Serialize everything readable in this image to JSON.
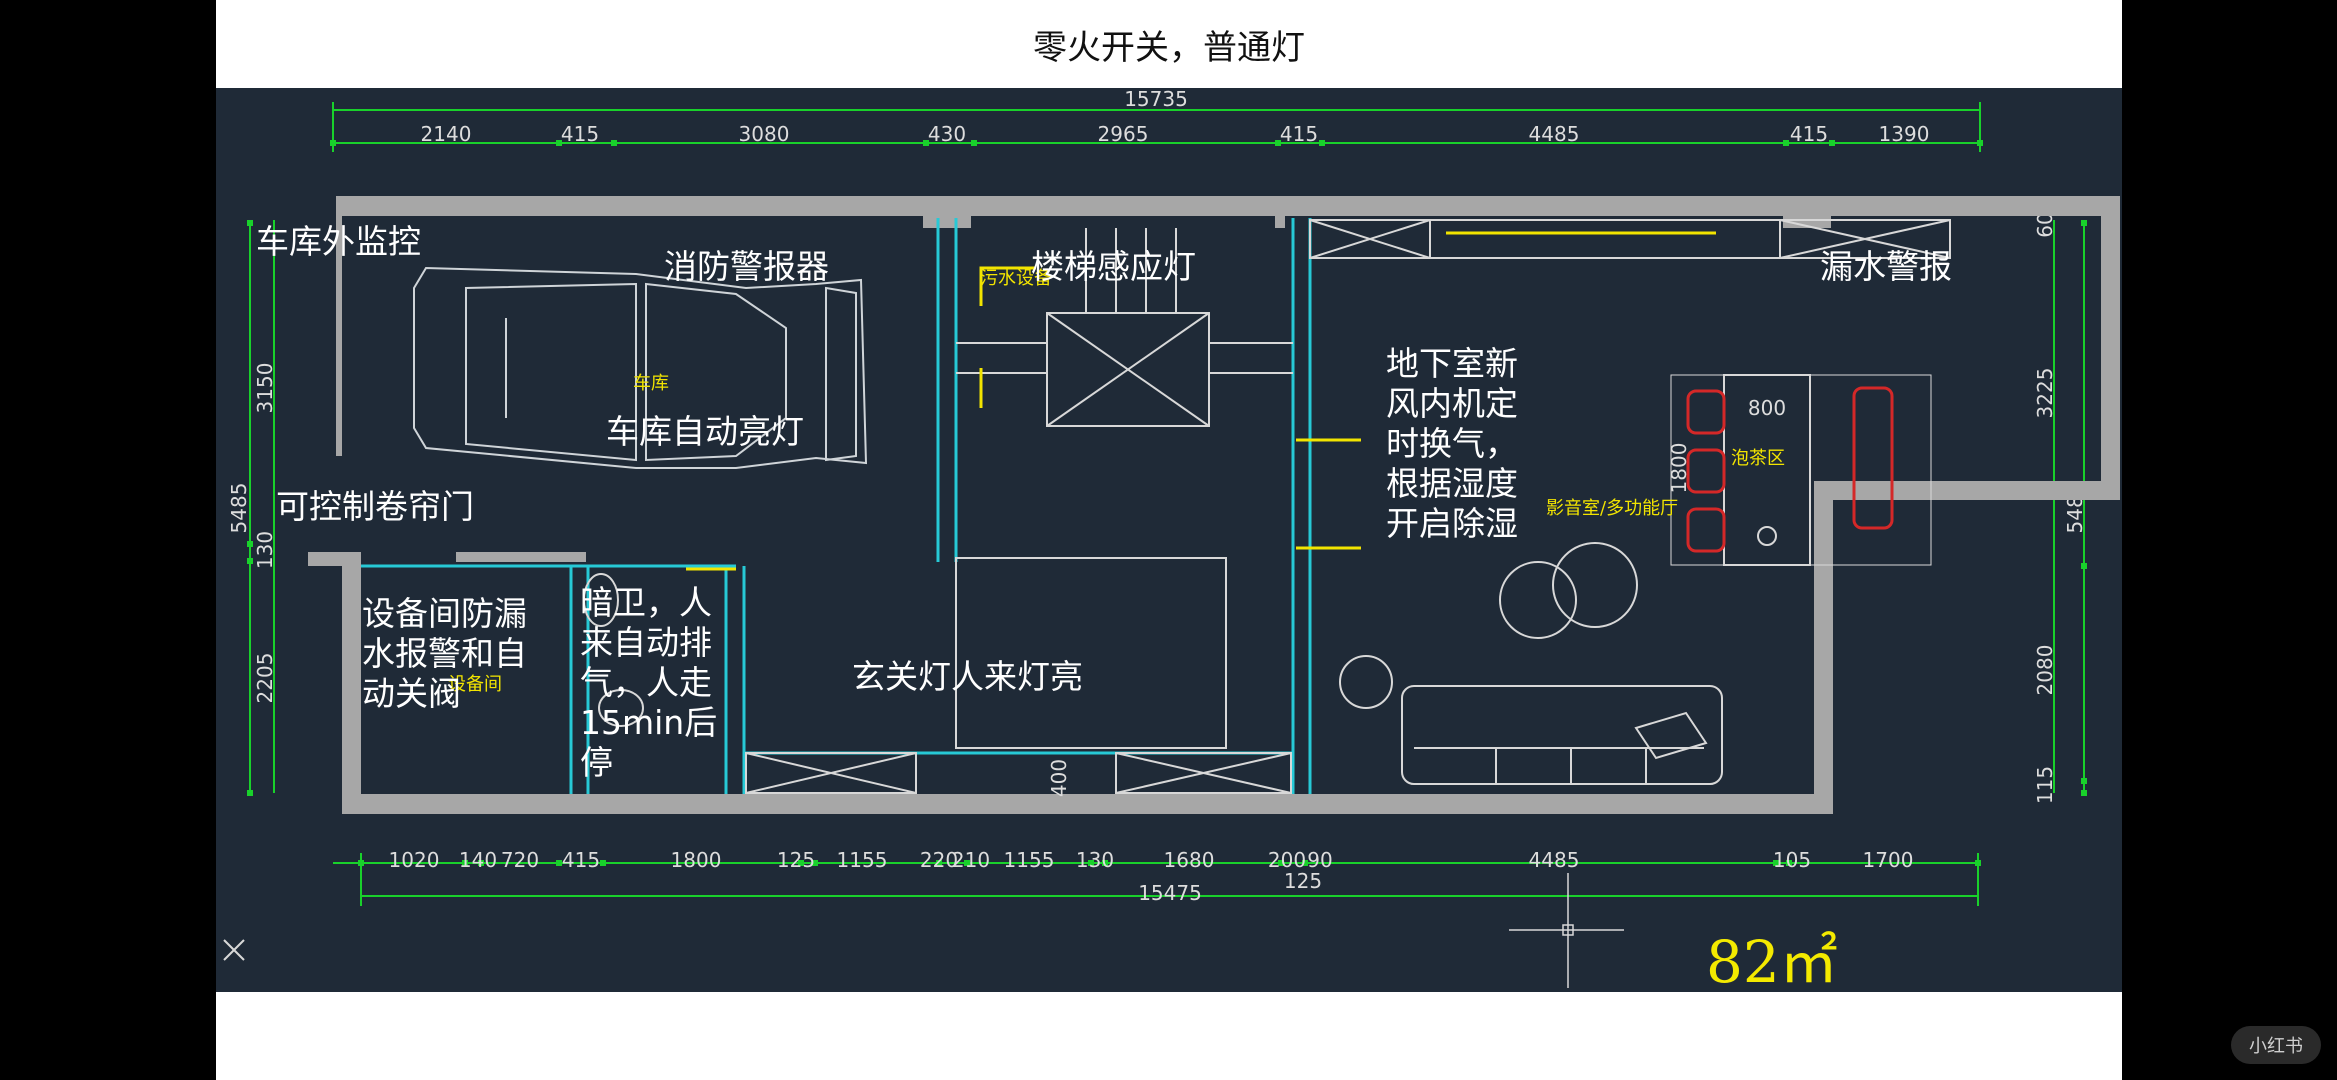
{
  "title": "零火开关，普通灯",
  "dims_top_total": "15735",
  "dims_top": [
    "2140",
    "415",
    "3080",
    "430",
    "2965",
    "415",
    "4485",
    "415",
    "1390"
  ],
  "dims_bottom": [
    "1020",
    "140",
    "720",
    "415",
    "1800",
    "125",
    "1155",
    "220",
    "210",
    "1155",
    "130",
    "1680",
    "200",
    "90",
    "4485",
    "105",
    "1700"
  ],
  "dims_bottom_extra": "125",
  "dims_bottom_total": "15475",
  "dims_left": [
    "3150",
    "130",
    "2205"
  ],
  "dims_left_total": "5485",
  "dims_right": [
    "60",
    "3225",
    "2080",
    "115"
  ],
  "dims_right_total": "5480",
  "dim_inner_800": "800",
  "dim_inner_1800": "1800",
  "dim_inner_400": "400",
  "notes": {
    "garage_camera": "车库外监控",
    "fire_alarm": "消防警报器",
    "stair_light": "楼梯感应灯",
    "leak_alarm": "漏水警报",
    "garage_light": "车库自动亮灯",
    "roller_door": "可控制卷帘门",
    "equipment_room": [
      "设备间防漏",
      "水报警和自",
      "动关阀"
    ],
    "hidden_wc": [
      "暗卫，人",
      "来自动排",
      "气，人走",
      "15min后",
      "停"
    ],
    "entry_light": "玄关灯人来灯亮",
    "basement_air": [
      "地下室新",
      "风内机定",
      "时换气，",
      "根据湿度",
      "开启除湿"
    ]
  },
  "room_labels": {
    "garage": "车库",
    "sewage": "污水设备",
    "tea": "泡茶区",
    "leisure": "影音室/多功能厅",
    "equipment": "设备间"
  },
  "area_label": "82㎡",
  "watermark": "小红书",
  "colors": {
    "background": "#1f2a37",
    "wall": "#a7a7a7",
    "dim_line": "#19d12b",
    "cyan": "#27c9d6",
    "yellow": "#f2e400",
    "red": "#d42828"
  }
}
